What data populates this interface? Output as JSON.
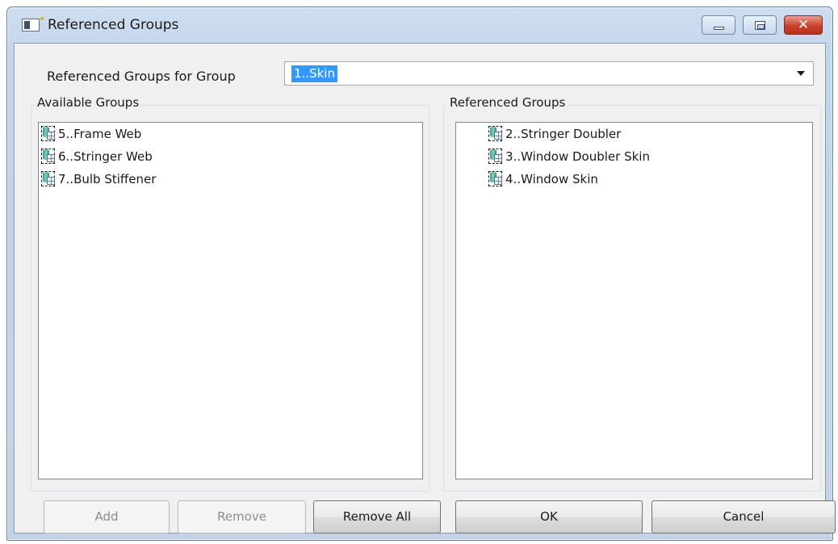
{
  "window": {
    "title": "Referenced Groups",
    "controls": {
      "minimize": "minimize",
      "maximize": "maximize",
      "close": "✕"
    }
  },
  "selector": {
    "label": "Referenced Groups for Group",
    "selected_value": "1..Skin"
  },
  "available_groups": {
    "title": "Available Groups",
    "items": [
      "5..Frame Web",
      "6..Stringer Web",
      "7..Bulb Stiffener"
    ]
  },
  "referenced_groups": {
    "title": "Referenced Groups",
    "items": [
      "2..Stringer Doubler",
      "3..Window Doubler Skin",
      "4..Window Skin"
    ]
  },
  "buttons": {
    "add": {
      "label": "Add",
      "enabled": false
    },
    "remove": {
      "label": "Remove",
      "enabled": false
    },
    "remove_all": {
      "label": "Remove All",
      "enabled": true
    },
    "ok": {
      "label": "OK",
      "enabled": true
    },
    "cancel": {
      "label": "Cancel",
      "enabled": true
    }
  },
  "icons": {
    "item_icon": "group-icon",
    "app_icon": "app-window-icon"
  }
}
